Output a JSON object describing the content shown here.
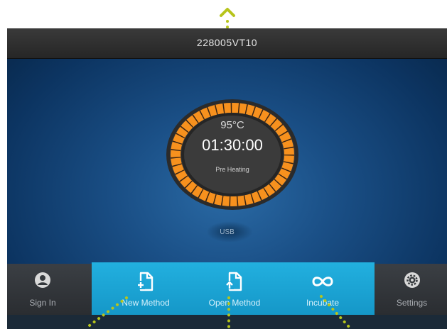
{
  "device": {
    "title": "228005VT10"
  },
  "dial": {
    "temperature": "95°C",
    "time": "01:30:00",
    "status": "Pre Heating"
  },
  "usb_label": "USB",
  "nav": {
    "sign_in": "Sign In",
    "new_method": "New Method",
    "open_method": "Open Method",
    "incubate": "Incubate",
    "settings": "Settings"
  },
  "icons": {
    "sign_in": "user-icon",
    "new_method": "new-document-icon",
    "open_method": "open-document-icon",
    "incubate": "infinity-icon",
    "settings": "gear-icon"
  },
  "colors": {
    "accent": "#1ea8db",
    "dial_orange": "#f7911e",
    "callout": "#b7c41b"
  }
}
